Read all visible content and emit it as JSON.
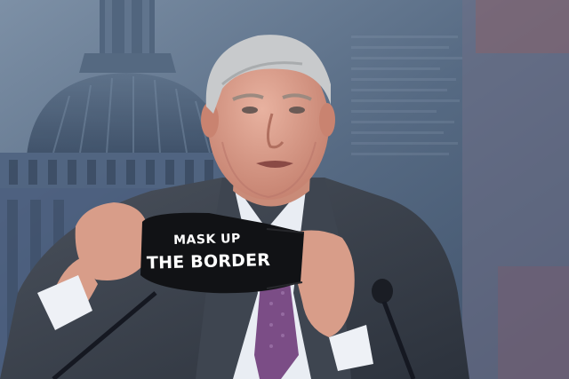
{
  "photo": {
    "scene": "press conference",
    "mask": {
      "line1": "MASK UP",
      "line2": "THE BORDER"
    },
    "colors": {
      "backdrop": "#5a6d86",
      "dome": "#4d6079",
      "suit": "#3a414d",
      "shirt": "#eef1f6",
      "tie": "#7b4d86",
      "skin": "#d69a86",
      "hair": "#c9cbcc",
      "mask_fabric": "#111215"
    }
  }
}
